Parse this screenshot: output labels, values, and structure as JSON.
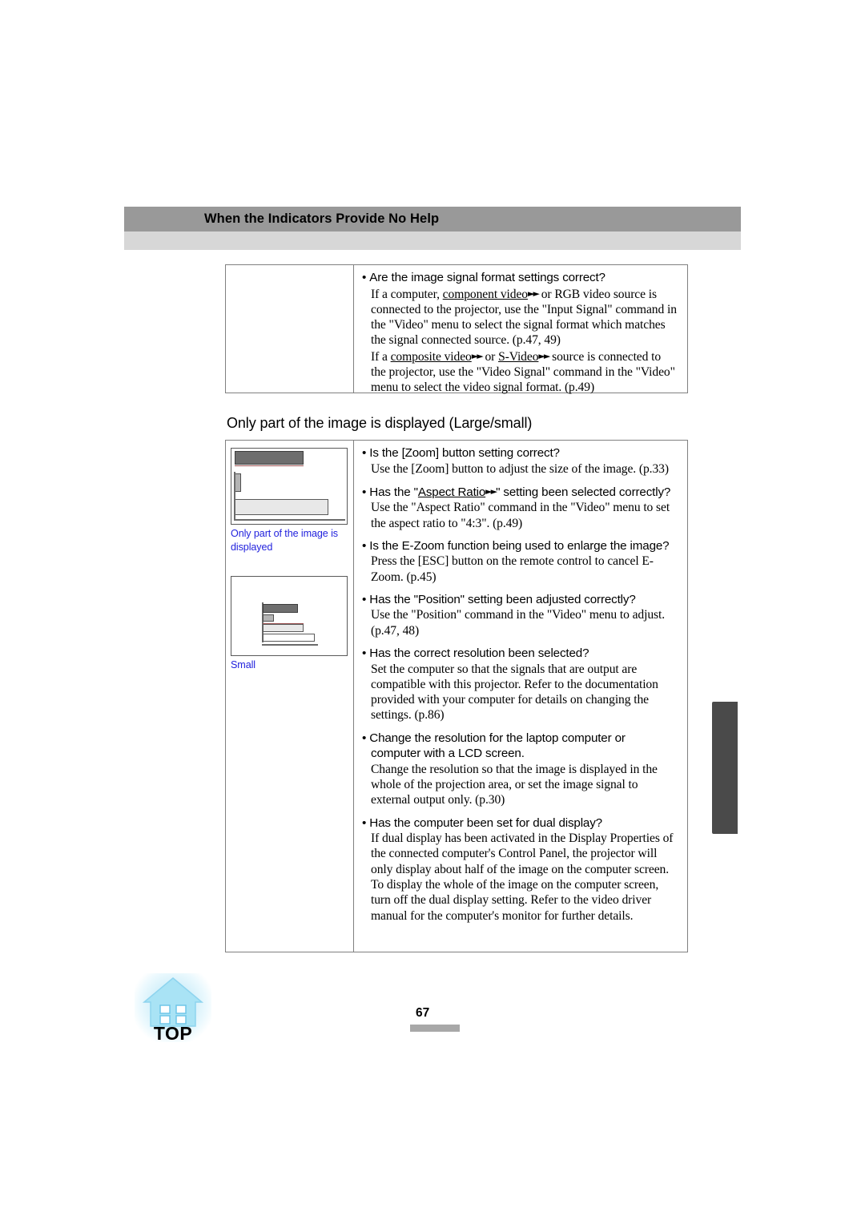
{
  "header": {
    "title": "When the Indicators Provide No Help"
  },
  "section_heading": "Only part of the image is displayed (Large/small)",
  "top_panel": {
    "items": [
      {
        "question": "Are the image signal format settings correct?",
        "answer_segments": [
          "If a computer, ",
          "component video",
          " or RGB video source is connected to the projector, use the \"Input Signal\" command in the \"Video\" menu to select the signal format which matches the signal connected source. (p.47, 49)",
          "If a ",
          "composite video",
          " or ",
          "S-Video",
          " source is connected to the projector, use the \"Video Signal\" command in the \"Video\" menu to select the video signal format. (p.49)"
        ]
      }
    ]
  },
  "main_panel": {
    "illustrations": [
      {
        "name": "large-example",
        "caption": "Only part of the image is displayed"
      },
      {
        "name": "small-example",
        "caption": "Small"
      }
    ],
    "items": [
      {
        "question": "Is the [Zoom] button setting correct?",
        "answer": "Use the [Zoom] button to adjust the size of the image. (p.33)"
      },
      {
        "question_pre": "Has the \"",
        "question_link": "Aspect Ratio",
        "question_post": "\" setting been selected correctly?",
        "answer": "Use the \"Aspect Ratio\" command in the \"Video\" menu to set the aspect ratio to \"4:3\". (p.49)"
      },
      {
        "question": "Is the E-Zoom function being used to enlarge the image?",
        "answer": "Press the [ESC] button on the remote control to cancel E-Zoom. (p.45)"
      },
      {
        "question": "Has the \"Position\" setting been adjusted correctly?",
        "answer": "Use the \"Position\" command in the \"Video\" menu to adjust. (p.47, 48)"
      },
      {
        "question": "Has the correct resolution been selected?",
        "answer": "Set the computer so that the signals that are output are compatible with this projector. Refer to the documentation provided with your computer for details on changing the settings. (p.86)"
      },
      {
        "question": "Change the resolution for the laptop computer or computer with a LCD screen.",
        "answer": "Change the resolution so that the image is displayed in the whole of the projection area, or set the image signal to external output only. (p.30)"
      },
      {
        "question": "Has the computer been set for dual display?",
        "answer": "If dual display has been activated in the Display Properties of the connected computer's Control Panel, the projector will only display about half of the image on the computer screen. To display the whole of the image on the computer screen, turn off the dual display setting. Refer to the video driver manual for the computer's monitor for further details."
      }
    ]
  },
  "top_button": {
    "label": "TOP",
    "icon": "home-icon"
  },
  "footer": {
    "page_number": "67"
  },
  "colors": {
    "header_dark": "#999999",
    "header_light": "#d7d7d7",
    "caption_blue": "#2222dd",
    "edge_tab": "#4a4a4a"
  }
}
